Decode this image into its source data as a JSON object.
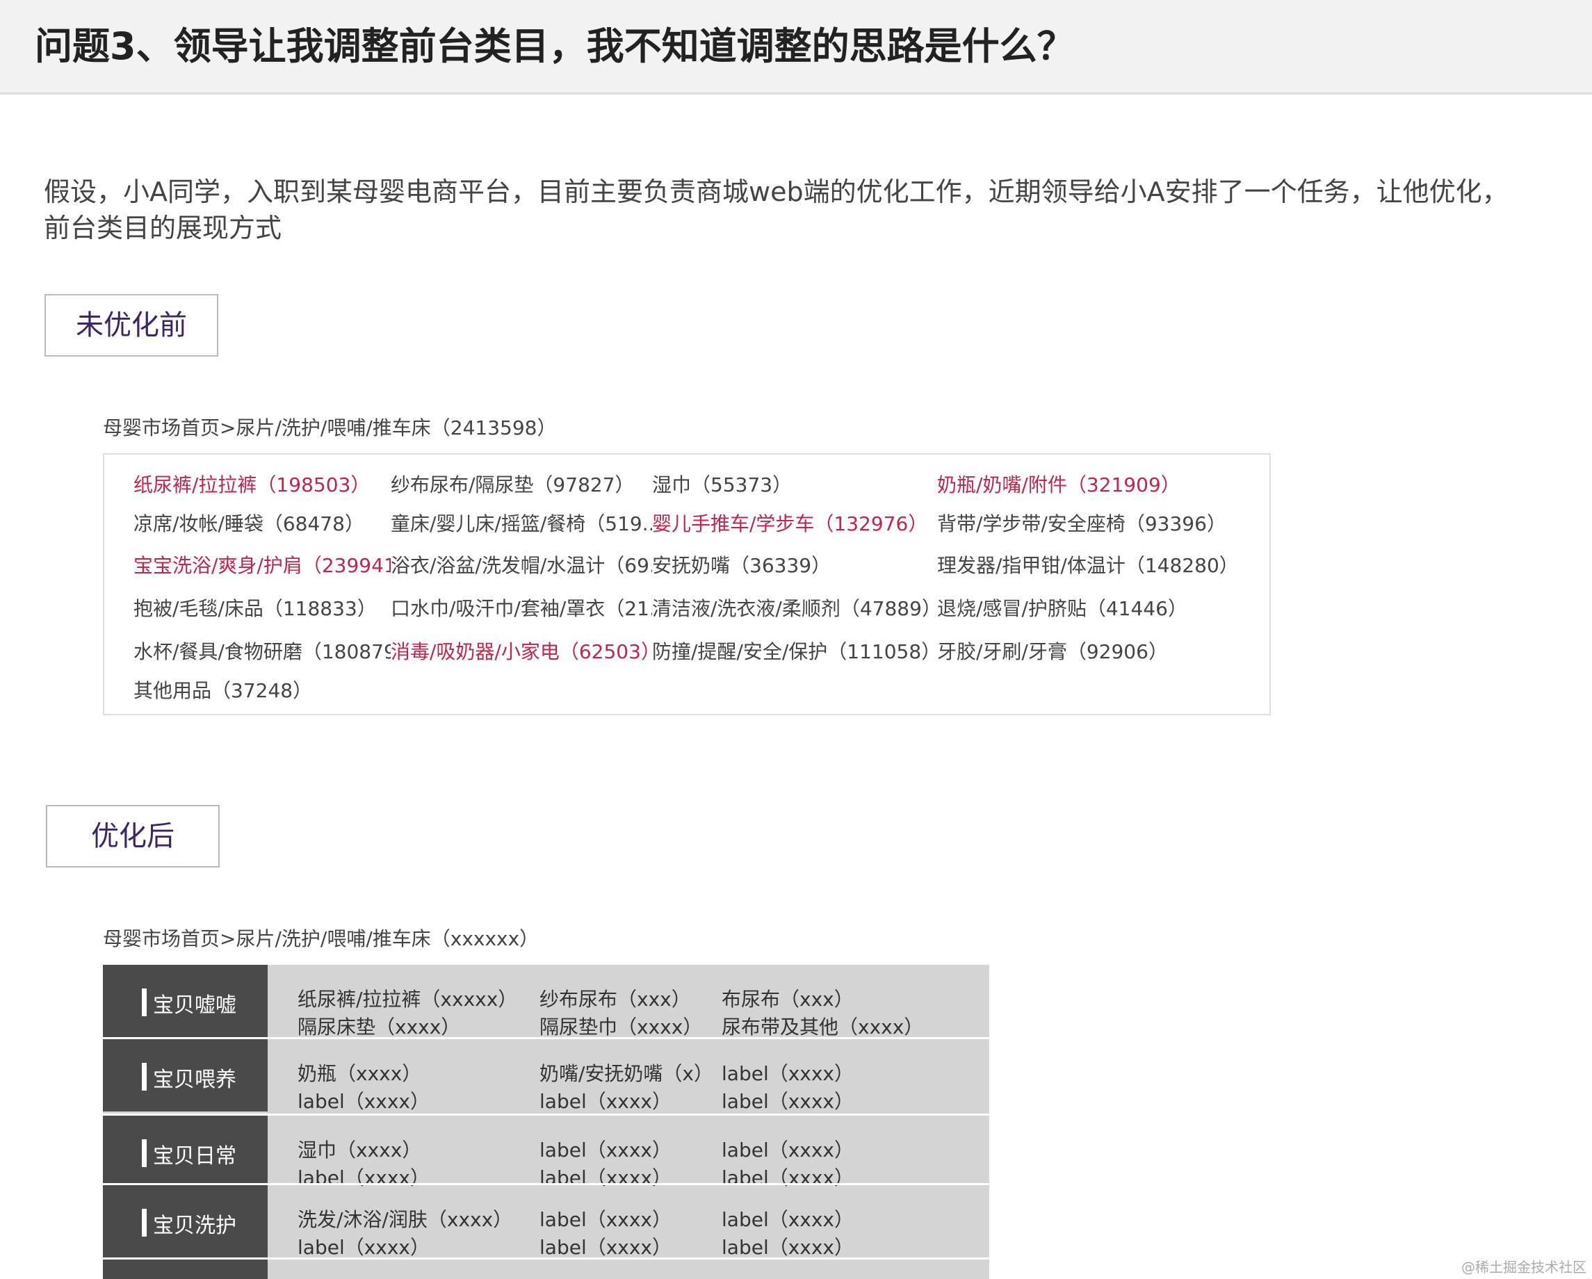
{
  "header": {
    "title": "问题3、领导让我调整前台类目，我不知道调整的思路是什么？"
  },
  "intro": "假设，小A同学，入职到某母婴电商平台，目前主要负责商城web端的优化工作，近期领导给小A安排了一个任务，让他优化，前台类目的展现方式",
  "before": {
    "label": "未优化前",
    "breadcrumb": "母婴市场首页>尿片/洗护/喂哺/推车床（2413598）",
    "rows": [
      [
        {
          "text": "纸尿裤/拉拉裤（198503）",
          "highlight": true
        },
        {
          "text": "纱布尿布/隔尿垫（97827）",
          "highlight": false
        },
        {
          "text": "湿巾（55373）",
          "highlight": false
        },
        {
          "text": "奶瓶/奶嘴/附件（321909）",
          "highlight": true
        }
      ],
      [
        {
          "text": "凉席/妆帐/睡袋（68478）",
          "highlight": false
        },
        {
          "text": "童床/婴儿床/摇篮/餐椅（519...",
          "highlight": false
        },
        {
          "text": "婴儿手推车/学步车（132976）",
          "highlight": true
        },
        {
          "text": "背带/学步带/安全座椅（93396）",
          "highlight": false
        }
      ],
      [
        {
          "text": "宝宝洗浴/爽身/护肩（239941",
          "highlight": true
        },
        {
          "text": "浴衣/浴盆/洗发帽/水温计（69.",
          "highlight": false
        },
        {
          "text": "安抚奶嘴（36339）",
          "highlight": false
        },
        {
          "text": "理发器/指甲钳/体温计（148280）",
          "highlight": false
        }
      ],
      [
        {
          "text": "抱被/毛毯/床品（118833）",
          "highlight": false
        },
        {
          "text": "口水巾/吸汗巾/套袖/罩衣（21.",
          "highlight": false
        },
        {
          "text": "清洁液/洗衣液/柔顺剂（47889）",
          "highlight": false
        },
        {
          "text": "退烧/感冒/护脐贴（41446）",
          "highlight": false
        }
      ],
      [
        {
          "text": "水杯/餐具/食物研磨（180879",
          "highlight": false
        },
        {
          "text": "消毒/吸奶器/小家电（62503）",
          "highlight": true
        },
        {
          "text": "防撞/提醒/安全/保护（111058）",
          "highlight": false
        },
        {
          "text": "牙胶/牙刷/牙膏（92906）",
          "highlight": false
        }
      ],
      [
        {
          "text": "其他用品（37248）",
          "highlight": false
        }
      ]
    ]
  },
  "after": {
    "label": "优化后",
    "breadcrumb": "母婴市场首页>尿片/洗护/喂哺/推车床（xxxxxx）",
    "groups": [
      {
        "name": "宝贝嘘嘘",
        "lines": [
          [
            "纸尿裤/拉拉裤（xxxxx）",
            "纱布尿布（xxx）",
            "布尿布（xxx）"
          ],
          [
            "隔尿床垫（xxxx）",
            "隔尿垫巾（xxxx）",
            "尿布带及其他（xxxx）"
          ]
        ]
      },
      {
        "name": "宝贝喂养",
        "lines": [
          [
            "奶瓶（xxxx）",
            "奶嘴/安抚奶嘴（x）",
            "label（xxxx）"
          ],
          [
            "label（xxxx）",
            "label（xxxx）",
            "label（xxxx）"
          ]
        ]
      },
      {
        "name": "宝贝日常",
        "lines": [
          [
            "湿巾（xxxx）",
            "label（xxxx）",
            "label（xxxx）"
          ],
          [
            "label（xxxx）",
            "label（xxxx）",
            "label（xxxx）"
          ]
        ]
      },
      {
        "name": "宝贝洗护",
        "lines": [
          [
            "洗发/沐浴/润肤（xxxx）",
            "label（xxxx）",
            "label（xxxx）"
          ],
          [
            "label（xxxx）",
            "label（xxxx）",
            "label（xxxx）"
          ]
        ]
      }
    ]
  },
  "watermark": "@稀土掘金技术社区",
  "colors": {
    "highlight": "#c0254a",
    "label_text": "#3d2466",
    "group_header_bg": "#4a4a4a",
    "table_bg": "#d4d4d4"
  }
}
